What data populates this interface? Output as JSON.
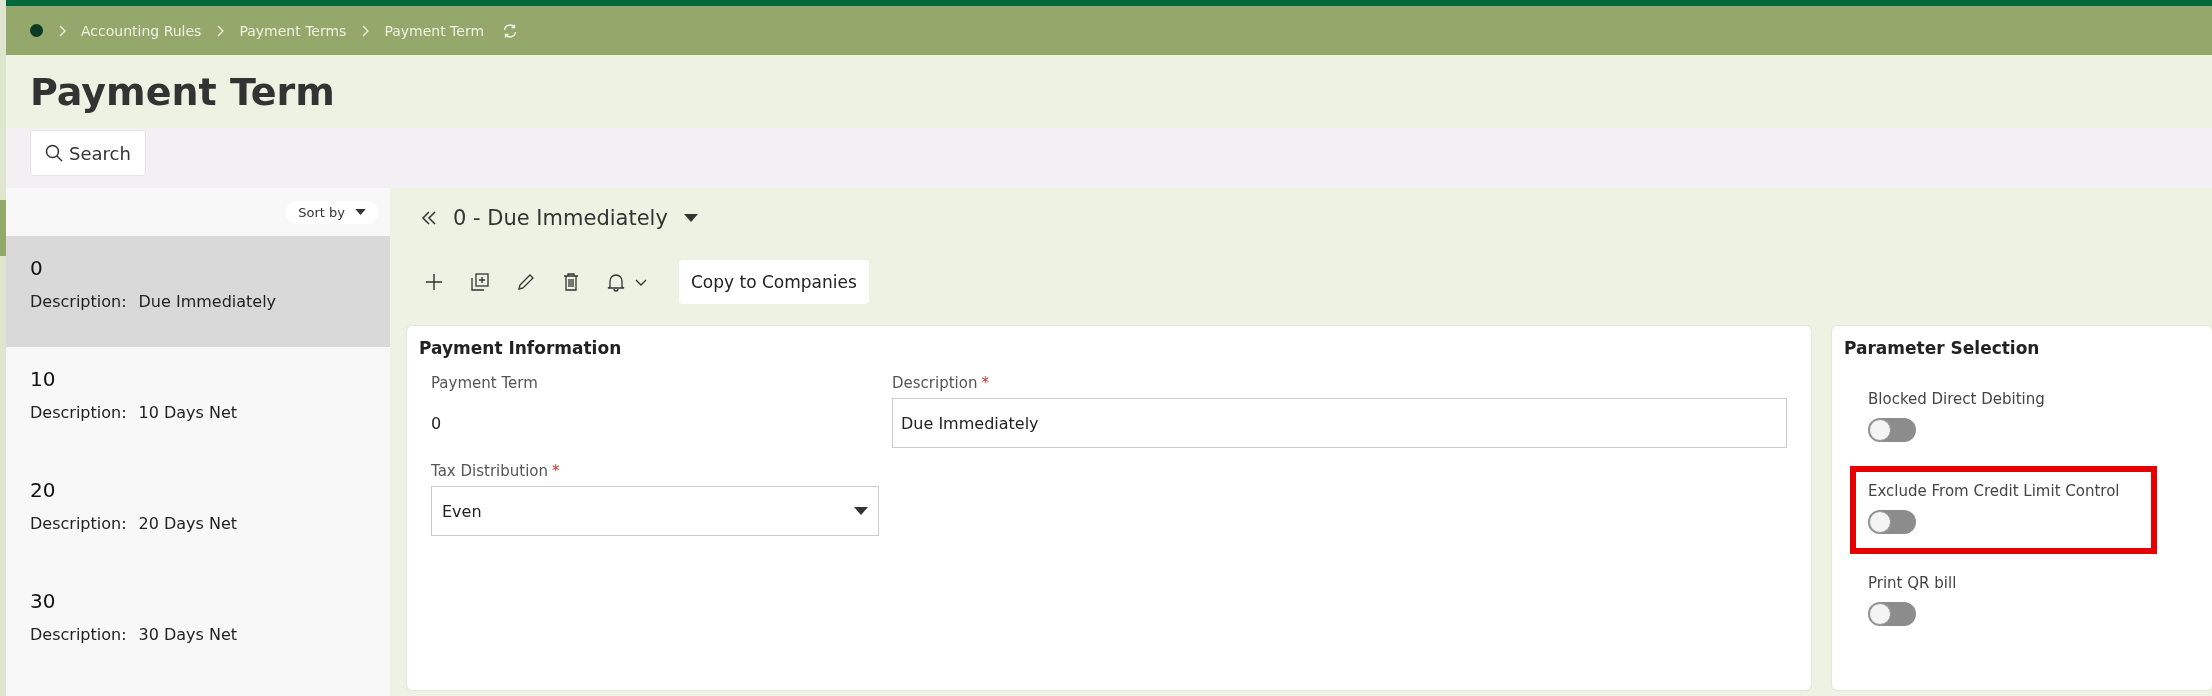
{
  "breadcrumbs": [
    "Accounting Rules",
    "Payment Terms",
    "Payment Term"
  ],
  "page_title": "Payment Term",
  "search_button": "Search",
  "sort_button": "Sort by",
  "list_items": [
    {
      "number": "0",
      "description_label": "Description:",
      "description": "Due Immediately",
      "selected": true
    },
    {
      "number": "10",
      "description_label": "Description:",
      "description": "10 Days Net",
      "selected": false
    },
    {
      "number": "20",
      "description_label": "Description:",
      "description": "20 Days Net",
      "selected": false
    },
    {
      "number": "30",
      "description_label": "Description:",
      "description": "30 Days Net",
      "selected": false
    }
  ],
  "record_title": "0 - Due Immediately",
  "toolbar": {
    "copy_button": "Copy to Companies"
  },
  "payment_information": {
    "title": "Payment Information",
    "payment_term": {
      "label": "Payment Term",
      "value": "0"
    },
    "description": {
      "label": "Description",
      "required_mark": "*",
      "value": "Due Immediately"
    },
    "tax_distribution": {
      "label": "Tax Distribution",
      "required_mark": "*",
      "value": "Even"
    }
  },
  "parameter_selection": {
    "title": "Parameter Selection",
    "toggles": [
      {
        "label": "Blocked Direct Debiting",
        "on": false,
        "highlighted": false
      },
      {
        "label": "Exclude From Credit Limit Control",
        "on": false,
        "highlighted": true
      },
      {
        "label": "Print QR bill",
        "on": false,
        "highlighted": false
      }
    ]
  }
}
